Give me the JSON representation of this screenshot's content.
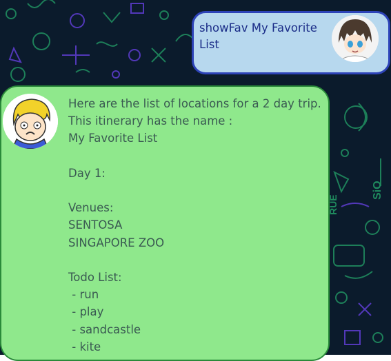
{
  "user_message": {
    "text": "showFav My Favorite List"
  },
  "bot_message": {
    "lines": [
      "Here are the list of locations for a 2 day trip.",
      "This itinerary has the name :",
      "My Favorite List",
      "",
      "Day 1:",
      "",
      "Venues:",
      "SENTOSA",
      "SINGAPORE ZOO",
      "",
      "Todo List:",
      " - run",
      " - play",
      " - sandcastle",
      " - kite"
    ]
  },
  "background": {
    "doodle_texts": [
      "RUE",
      "SiO"
    ]
  },
  "colors": {
    "background": "#0b1b2c",
    "doodle_green": "#1f8a5e",
    "doodle_purple": "#5a3cc9",
    "user_bubble": "#b7d8ee",
    "user_bubble_border": "#2d43b8",
    "user_text": "#1b2d88",
    "bot_bubble": "#8fe88c",
    "bot_bubble_border": "#2a8a3a",
    "bot_text": "#3a5a52"
  },
  "icons": {
    "user_avatar": "anime-boy-avatar",
    "bot_avatar": "blonde-cartoon-avatar"
  }
}
